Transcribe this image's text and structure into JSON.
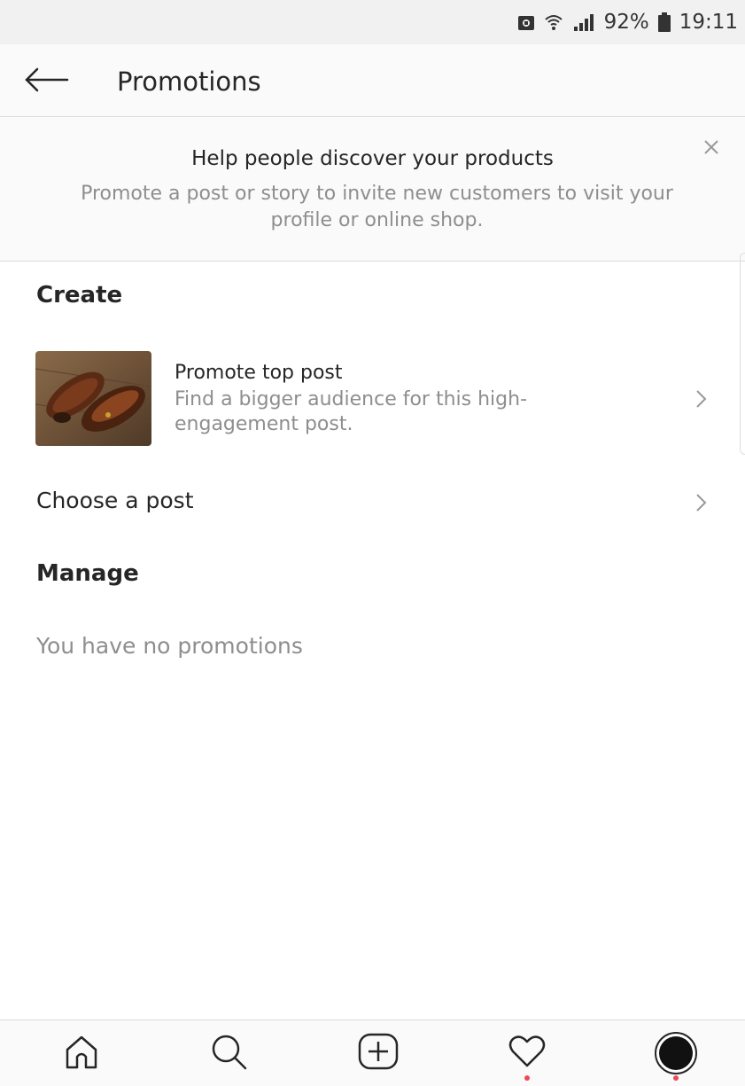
{
  "status_bar": {
    "battery_percent": "92%",
    "time": "19:11",
    "icons": [
      "store-icon",
      "wifi-icon",
      "signal-icon",
      "battery-icon"
    ]
  },
  "header": {
    "title": "Promotions",
    "back_icon": "arrow-left-icon"
  },
  "banner": {
    "title": "Help people discover your products",
    "subtitle": "Promote a post or story to invite new customers to visit your profile or online shop.",
    "close_icon": "close-icon"
  },
  "create_section": {
    "heading": "Create",
    "promote_top_post": {
      "title": "Promote top post",
      "description": "Find a bigger audience for this high-engagement post.",
      "thumbnail": "shoes-photo"
    },
    "choose_post_label": "Choose a post"
  },
  "manage_section": {
    "heading": "Manage",
    "empty_text": "You have no promotions"
  },
  "bottom_nav": {
    "items": [
      "home-icon",
      "search-icon",
      "add-post-icon",
      "activity-heart-icon",
      "profile-avatar"
    ],
    "notification_dot_color": "#ed4956"
  },
  "colors": {
    "text_primary": "#262626",
    "text_secondary": "#8e8e8e",
    "divider": "#dbdbdb",
    "banner_bg": "#fafafa"
  }
}
